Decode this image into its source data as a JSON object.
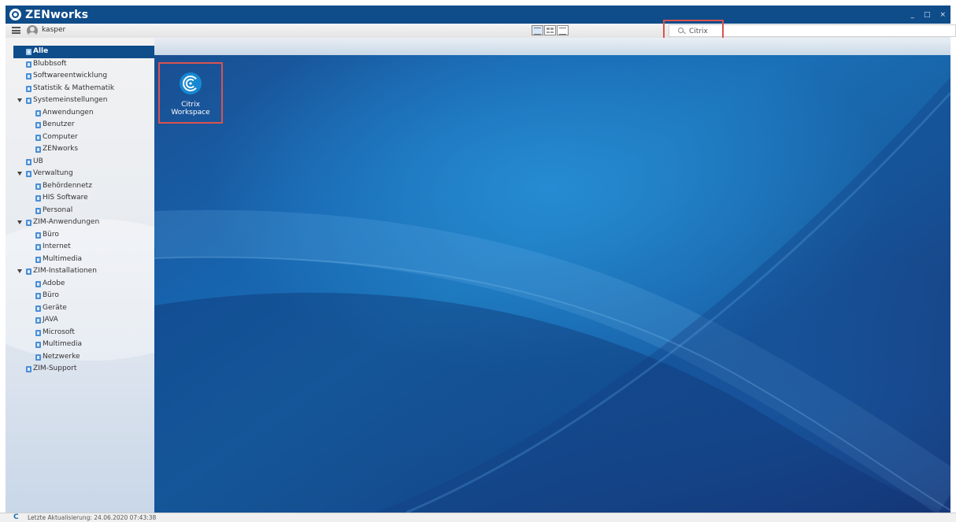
{
  "window": {
    "title": "ZENworks",
    "controls": {
      "minimize": "_",
      "maximize": "□",
      "close": "×"
    }
  },
  "toolbar": {
    "username": "kasper",
    "view_modes": [
      "tree-view",
      "icon-view",
      "list-view"
    ]
  },
  "search": {
    "value": "Citrix",
    "placeholder": ""
  },
  "tree": {
    "items": [
      {
        "label": "Alle",
        "level": 0,
        "selected": true,
        "expanded": false
      },
      {
        "label": "Blubbsoft",
        "level": 0,
        "selected": false,
        "expanded": false
      },
      {
        "label": "Softwareentwicklung",
        "level": 0,
        "selected": false,
        "expanded": false
      },
      {
        "label": "Statistik & Mathematik",
        "level": 0,
        "selected": false,
        "expanded": false
      },
      {
        "label": "Systemeinstellungen",
        "level": 0,
        "selected": false,
        "expanded": true
      },
      {
        "label": "Anwendungen",
        "level": 1,
        "selected": false,
        "expanded": false
      },
      {
        "label": "Benutzer",
        "level": 1,
        "selected": false,
        "expanded": false
      },
      {
        "label": "Computer",
        "level": 1,
        "selected": false,
        "expanded": false
      },
      {
        "label": "ZENworks",
        "level": 1,
        "selected": false,
        "expanded": false
      },
      {
        "label": "UB",
        "level": 0,
        "selected": false,
        "expanded": false
      },
      {
        "label": "Verwaltung",
        "level": 0,
        "selected": false,
        "expanded": true
      },
      {
        "label": "Behördennetz",
        "level": 1,
        "selected": false,
        "expanded": false
      },
      {
        "label": "HIS Software",
        "level": 1,
        "selected": false,
        "expanded": false
      },
      {
        "label": "Personal",
        "level": 1,
        "selected": false,
        "expanded": false
      },
      {
        "label": "ZIM-Anwendungen",
        "level": 0,
        "selected": false,
        "expanded": true
      },
      {
        "label": "Büro",
        "level": 1,
        "selected": false,
        "expanded": false
      },
      {
        "label": "Internet",
        "level": 1,
        "selected": false,
        "expanded": false
      },
      {
        "label": "Multimedia",
        "level": 1,
        "selected": false,
        "expanded": false
      },
      {
        "label": "ZIM-Installationen",
        "level": 0,
        "selected": false,
        "expanded": true
      },
      {
        "label": "Adobe",
        "level": 1,
        "selected": false,
        "expanded": false
      },
      {
        "label": "Büro",
        "level": 1,
        "selected": false,
        "expanded": false
      },
      {
        "label": "Geräte",
        "level": 1,
        "selected": false,
        "expanded": false
      },
      {
        "label": "JAVA",
        "level": 1,
        "selected": false,
        "expanded": false
      },
      {
        "label": "Microsoft",
        "level": 1,
        "selected": false,
        "expanded": false
      },
      {
        "label": "Multimedia",
        "level": 1,
        "selected": false,
        "expanded": false
      },
      {
        "label": "Netzwerke",
        "level": 1,
        "selected": false,
        "expanded": false
      },
      {
        "label": "ZIM-Support",
        "level": 0,
        "selected": false,
        "expanded": false
      }
    ]
  },
  "apps": [
    {
      "label": "Citrix Workspace",
      "icon": "citrix-workspace-icon"
    }
  ],
  "statusbar": {
    "text": "Letzte Aktualisierung: 24.06.2020 07:43:38"
  },
  "colors": {
    "titlebar": "#0f4c8a",
    "selection": "#0f4c8a",
    "highlight_border": "#d9534f",
    "citrix_blue": "#1788d2"
  }
}
